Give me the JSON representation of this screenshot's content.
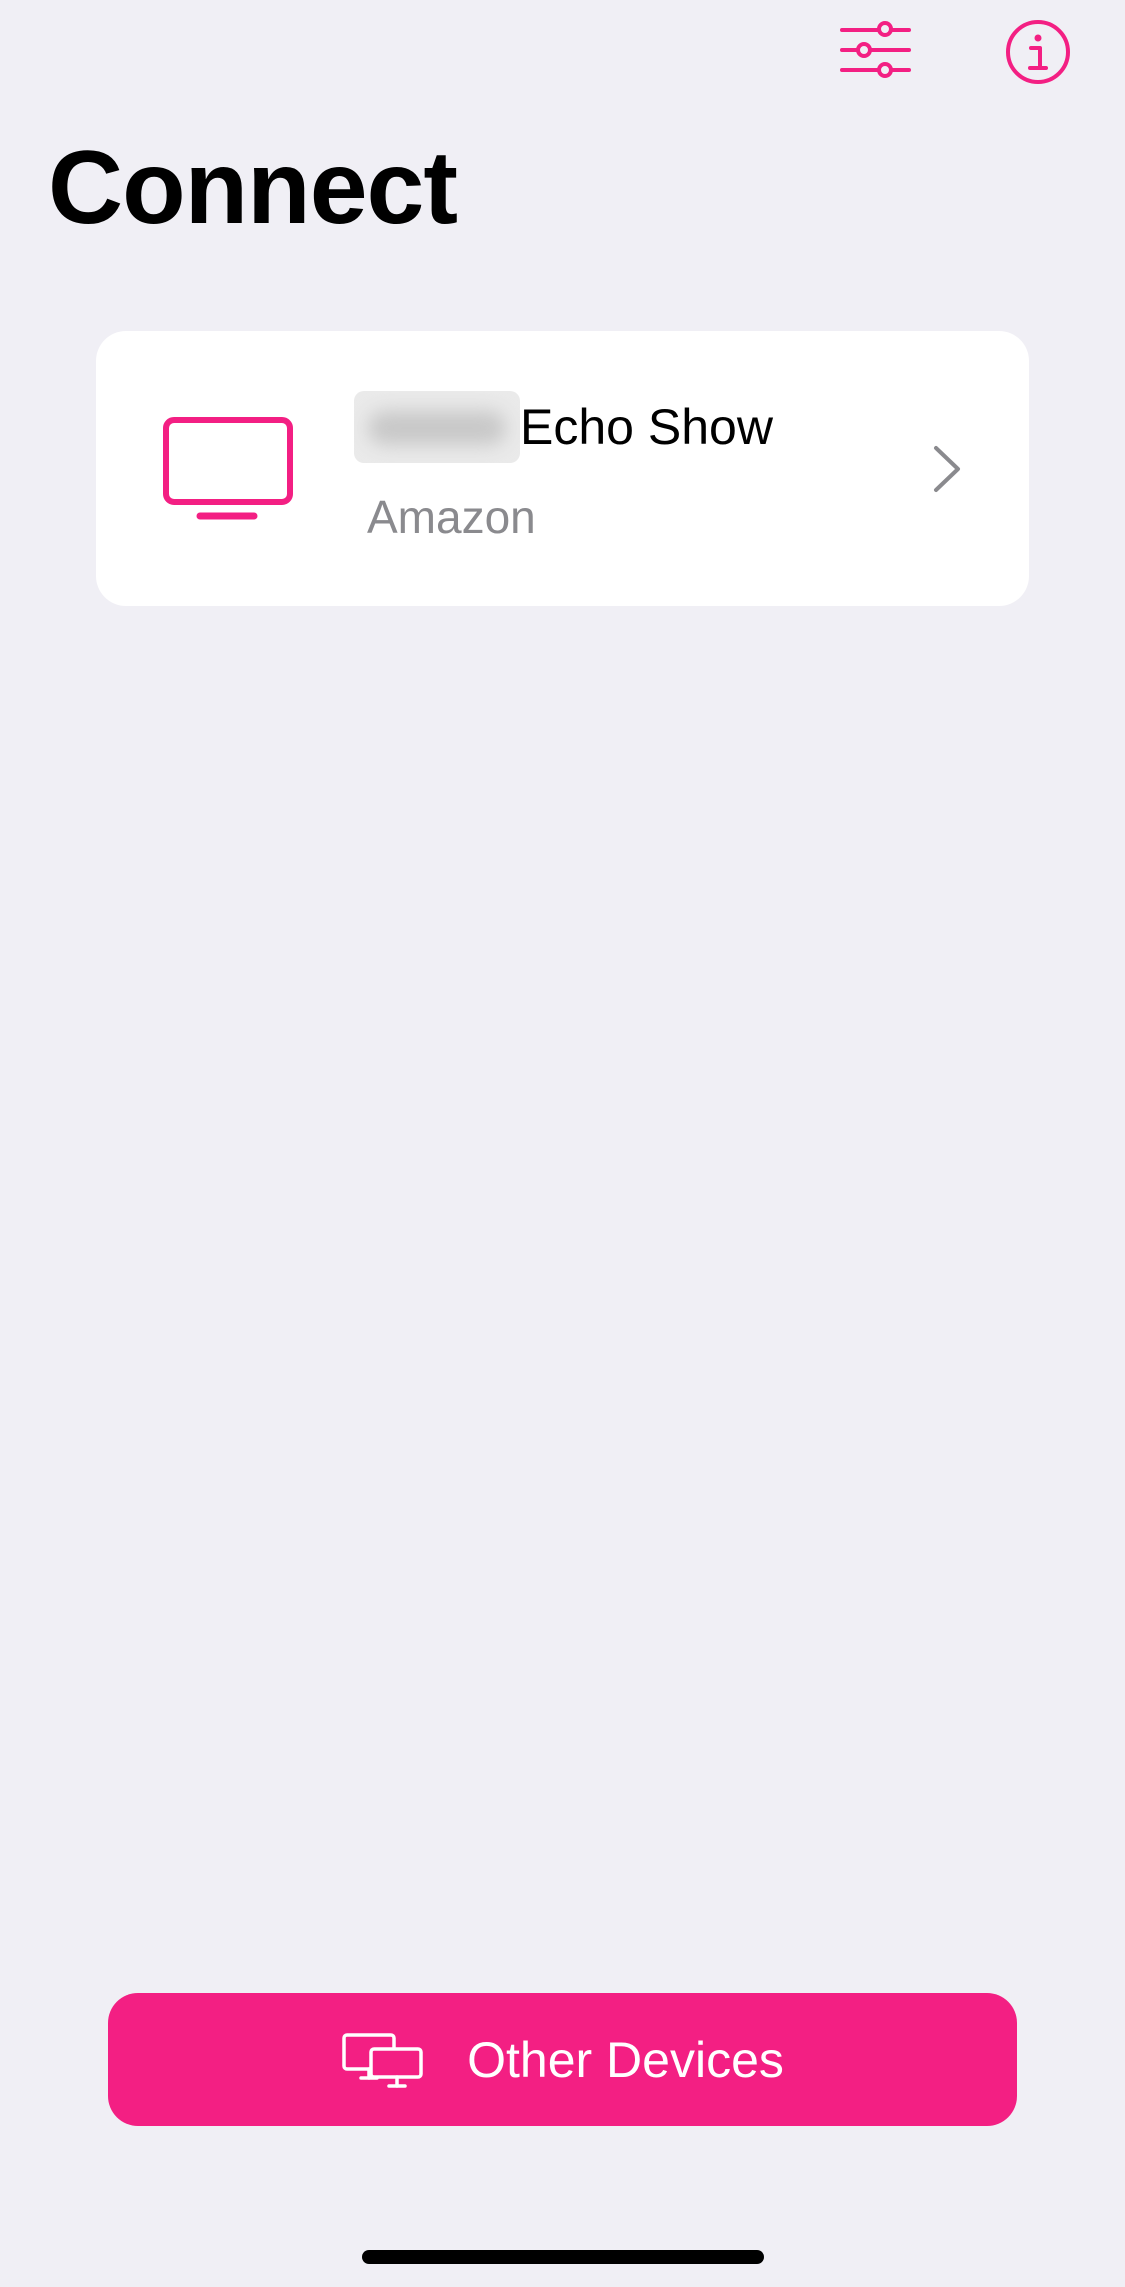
{
  "colors": {
    "accent": "#f31f83",
    "background": "#f0eff5",
    "card": "#ffffff",
    "secondary_text": "#8a8a8e"
  },
  "header": {
    "title": "Connect",
    "filter_icon": "sliders-icon",
    "info_icon": "info-icon"
  },
  "devices": [
    {
      "name": "Echo Show",
      "brand": "Amazon",
      "icon": "tv-icon"
    }
  ],
  "footer": {
    "other_devices_label": "Other Devices",
    "other_devices_icon": "devices-icon"
  }
}
